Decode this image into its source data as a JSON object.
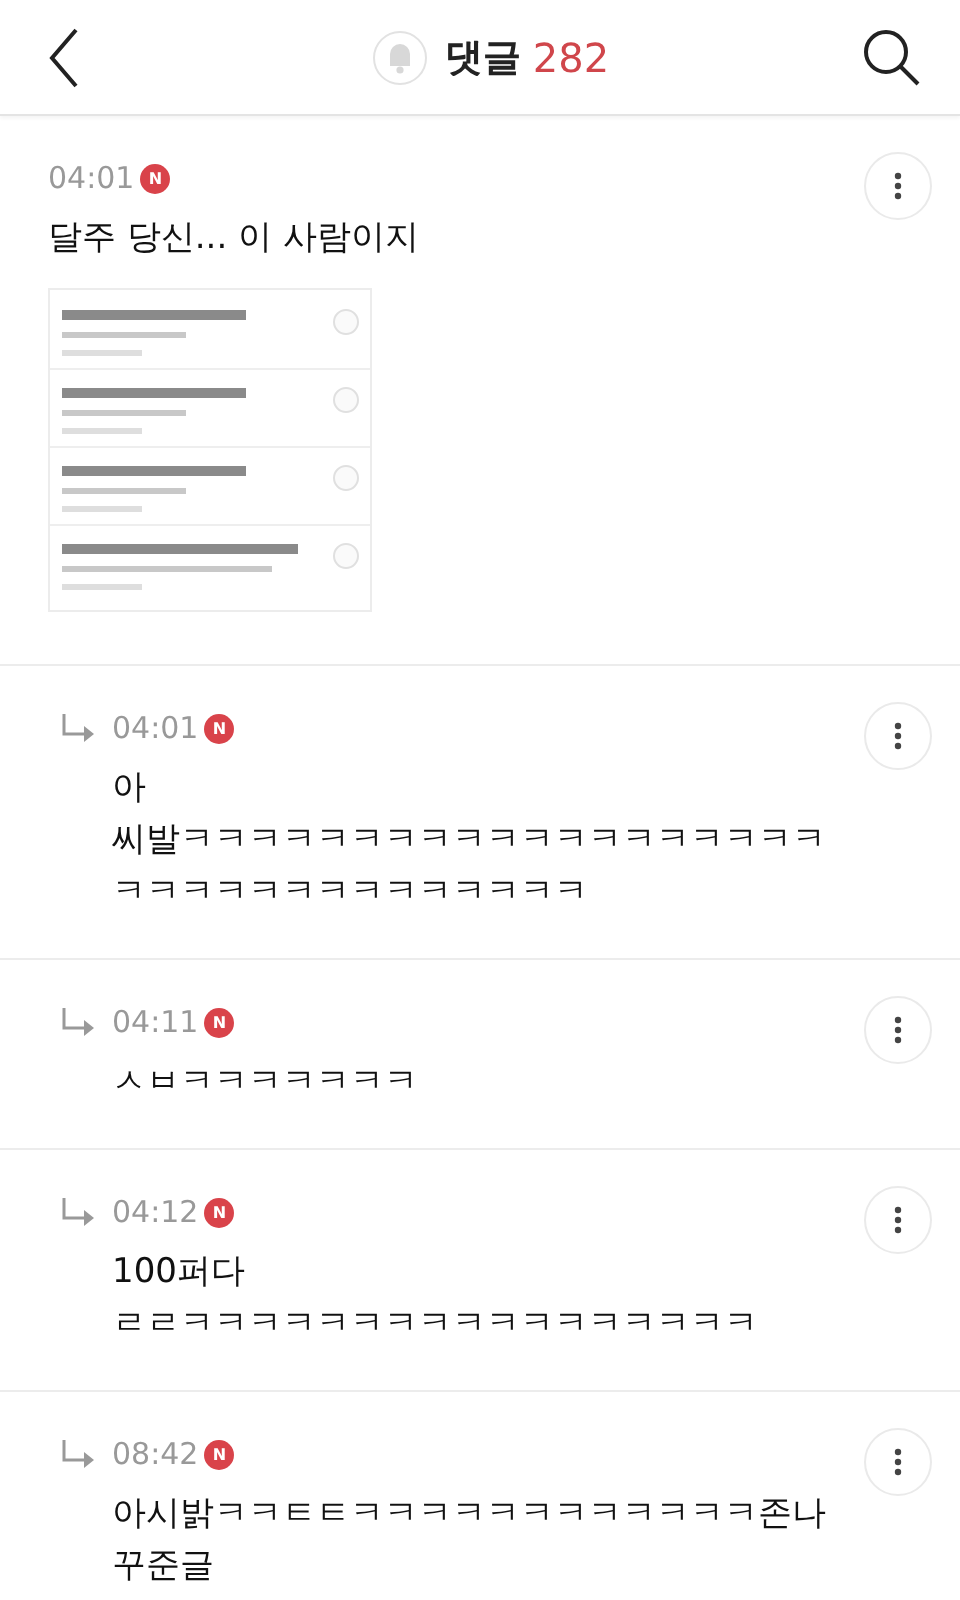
{
  "header": {
    "title": "댓글",
    "count": "282"
  },
  "comments": [
    {
      "kind": "comment",
      "time": "04:01",
      "badge": "N",
      "text": "달주 당신... 이 사람이지"
    },
    {
      "kind": "reply",
      "time": "04:01",
      "badge": "N",
      "text": "아\n씨발ㅋㅋㅋㅋㅋㅋㅋㅋㅋㅋㅋㅋㅋㅋㅋㅋㅋㅋㅋㅋㅋㅋㅋㅋㅋㅋㅋㅋㅋㅋㅋㅋㅋ"
    },
    {
      "kind": "reply",
      "time": "04:11",
      "badge": "N",
      "text": "ㅅㅂㅋㅋㅋㅋㅋㅋㅋ"
    },
    {
      "kind": "reply",
      "time": "04:12",
      "badge": "N",
      "text": "100퍼다\nㄹㄹㅋㅋㅋㅋㅋㅋㅋㅋㅋㅋㅋㅋㅋㅋㅋㅋㅋ"
    },
    {
      "kind": "reply",
      "time": "08:42",
      "badge": "N",
      "text": "아시밝ㅋㅋㅌㅌㅋㅋㅋㅋㅋㅋㅋㅋㅋㅋㅋㅋ존나꾸준글"
    }
  ]
}
